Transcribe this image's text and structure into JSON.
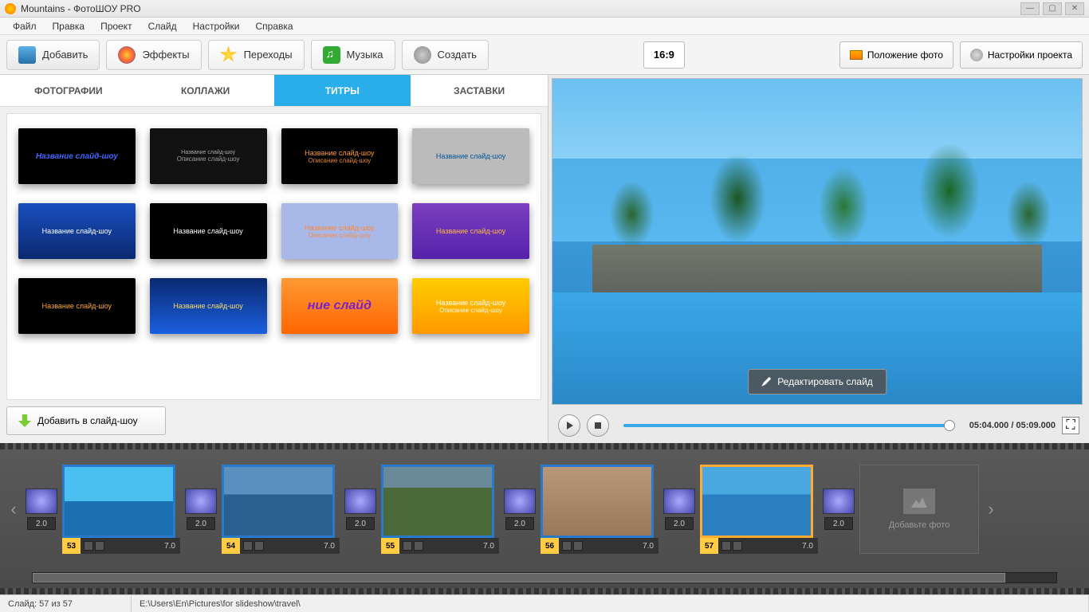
{
  "title": "Mountains - ФотоШОУ PRO",
  "menu": [
    "Файл",
    "Правка",
    "Проект",
    "Слайд",
    "Настройки",
    "Справка"
  ],
  "toolbar": {
    "add": "Добавить",
    "effects": "Эффекты",
    "transitions": "Переходы",
    "music": "Музыка",
    "create": "Создать"
  },
  "ratio": "16:9",
  "rightbuttons": {
    "photo_pos": "Положение фото",
    "proj_settings": "Настройки проекта"
  },
  "subtabs": {
    "photos": "ФОТОГРАФИИ",
    "collages": "КОЛЛАЖИ",
    "titles": "ТИТРЫ",
    "intros": "ЗАСТАВКИ"
  },
  "templates": [
    {
      "l1": "Название слайд-шоу",
      "l2": ""
    },
    {
      "l1": "Название слайд-шоу",
      "l2": "Описание слайд-шоу"
    },
    {
      "l1": "Название слайд-шоу",
      "l2": "Описание слайд-шоу"
    },
    {
      "l1": "Название слайд-шоу",
      "l2": ""
    },
    {
      "l1": "Название слайд-шоу",
      "l2": ""
    },
    {
      "l1": "Название слайд-шоу",
      "l2": ""
    },
    {
      "l1": "Название слайд-шоу",
      "l2": "Описание слайд-шоу"
    },
    {
      "l1": "Название слайд-шоу",
      "l2": ""
    },
    {
      "l1": "Название слайд-шоу",
      "l2": ""
    },
    {
      "l1": "Название слайд-шоу",
      "l2": ""
    },
    {
      "l1": "ние слайд",
      "l2": ""
    },
    {
      "l1": "Название слайд-шоу",
      "l2": "Описание слайд-шоу"
    }
  ],
  "add_to_show": "Добавить в слайд-шоу",
  "edit_slide": "Редактировать слайд",
  "time": {
    "current": "05:04.000",
    "total": "05:09.000"
  },
  "timeline": {
    "trans_dur": "2.0",
    "slides": [
      {
        "num": "53",
        "dur": "7.0"
      },
      {
        "num": "54",
        "dur": "7.0"
      },
      {
        "num": "55",
        "dur": "7.0"
      },
      {
        "num": "56",
        "dur": "7.0"
      },
      {
        "num": "57",
        "dur": "7.0"
      }
    ],
    "add_photo": "Добавьте фото"
  },
  "status": {
    "slide": "Слайд: 57 из 57",
    "path": "E:\\Users\\En\\Pictures\\for slideshow\\travel\\"
  }
}
